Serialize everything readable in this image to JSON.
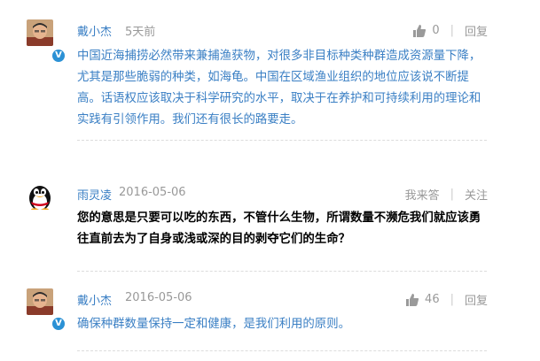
{
  "comments": [
    {
      "author": "戴小杰",
      "time": "5天前",
      "likes": "0",
      "reply_label": "回复",
      "verified_mark": "V",
      "body": "中国近海捕捞必然带来兼捕渔获物，对很多非目标种类种群造成资源量下降，尤其是那些脆弱的种类，如海龟。中国在区域渔业组织的地位应该说不断提高。话语权应该取决于科学研究的水平，取决于在养护和可持续利用的理论和实践有引领作用。我们还有很长的路要走。"
    },
    {
      "author": "雨灵凌",
      "time": "2016-05-06",
      "answer_label": "我来答",
      "follow_label": "关注",
      "body": "您的意思是只要可以吃的东西，不管什么生物，所谓数量不濒危我们就应该勇往直前去为了自身或浅或深的目的剥夺它们的生命？"
    },
    {
      "author": "戴小杰",
      "time": "2016-05-06",
      "likes": "46",
      "reply_label": "回复",
      "verified_mark": "V",
      "body": "确保种群数量保持一定和健康，是我们利用的原则。"
    }
  ],
  "colors": {
    "link_blue": "#3a7fc4",
    "verified_badge": "#2b91d5",
    "muted_gray": "#999999"
  },
  "icons": {
    "like": "thumbs-up-icon",
    "verified": "verified-v-icon",
    "qq_avatar": "qq-penguin-avatar"
  }
}
